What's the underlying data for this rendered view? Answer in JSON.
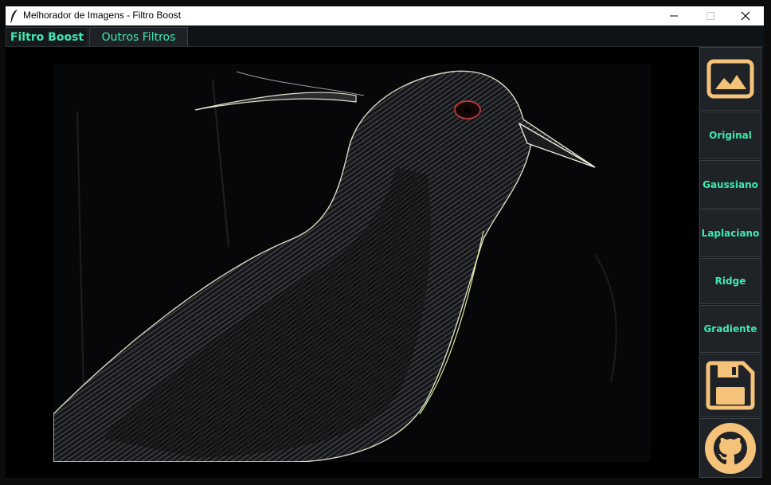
{
  "window": {
    "title": "Melhorador de Imagens - Filtro Boost"
  },
  "tabs": [
    {
      "label": "Filtro Boost"
    },
    {
      "label": "Outros Filtros"
    }
  ],
  "sidebar": {
    "buttons": [
      {
        "label": "Original"
      },
      {
        "label": "Gaussiano"
      },
      {
        "label": "Laplaciano"
      },
      {
        "label": "Ridge"
      },
      {
        "label": "Gradiente"
      }
    ],
    "icons": {
      "open": "image-icon",
      "save": "floppy-disk-icon",
      "github": "github-icon"
    }
  },
  "colors": {
    "accent": "#3de8b0",
    "icon": "#f5c27a",
    "panel": "#1f2327",
    "background": "#000000"
  }
}
